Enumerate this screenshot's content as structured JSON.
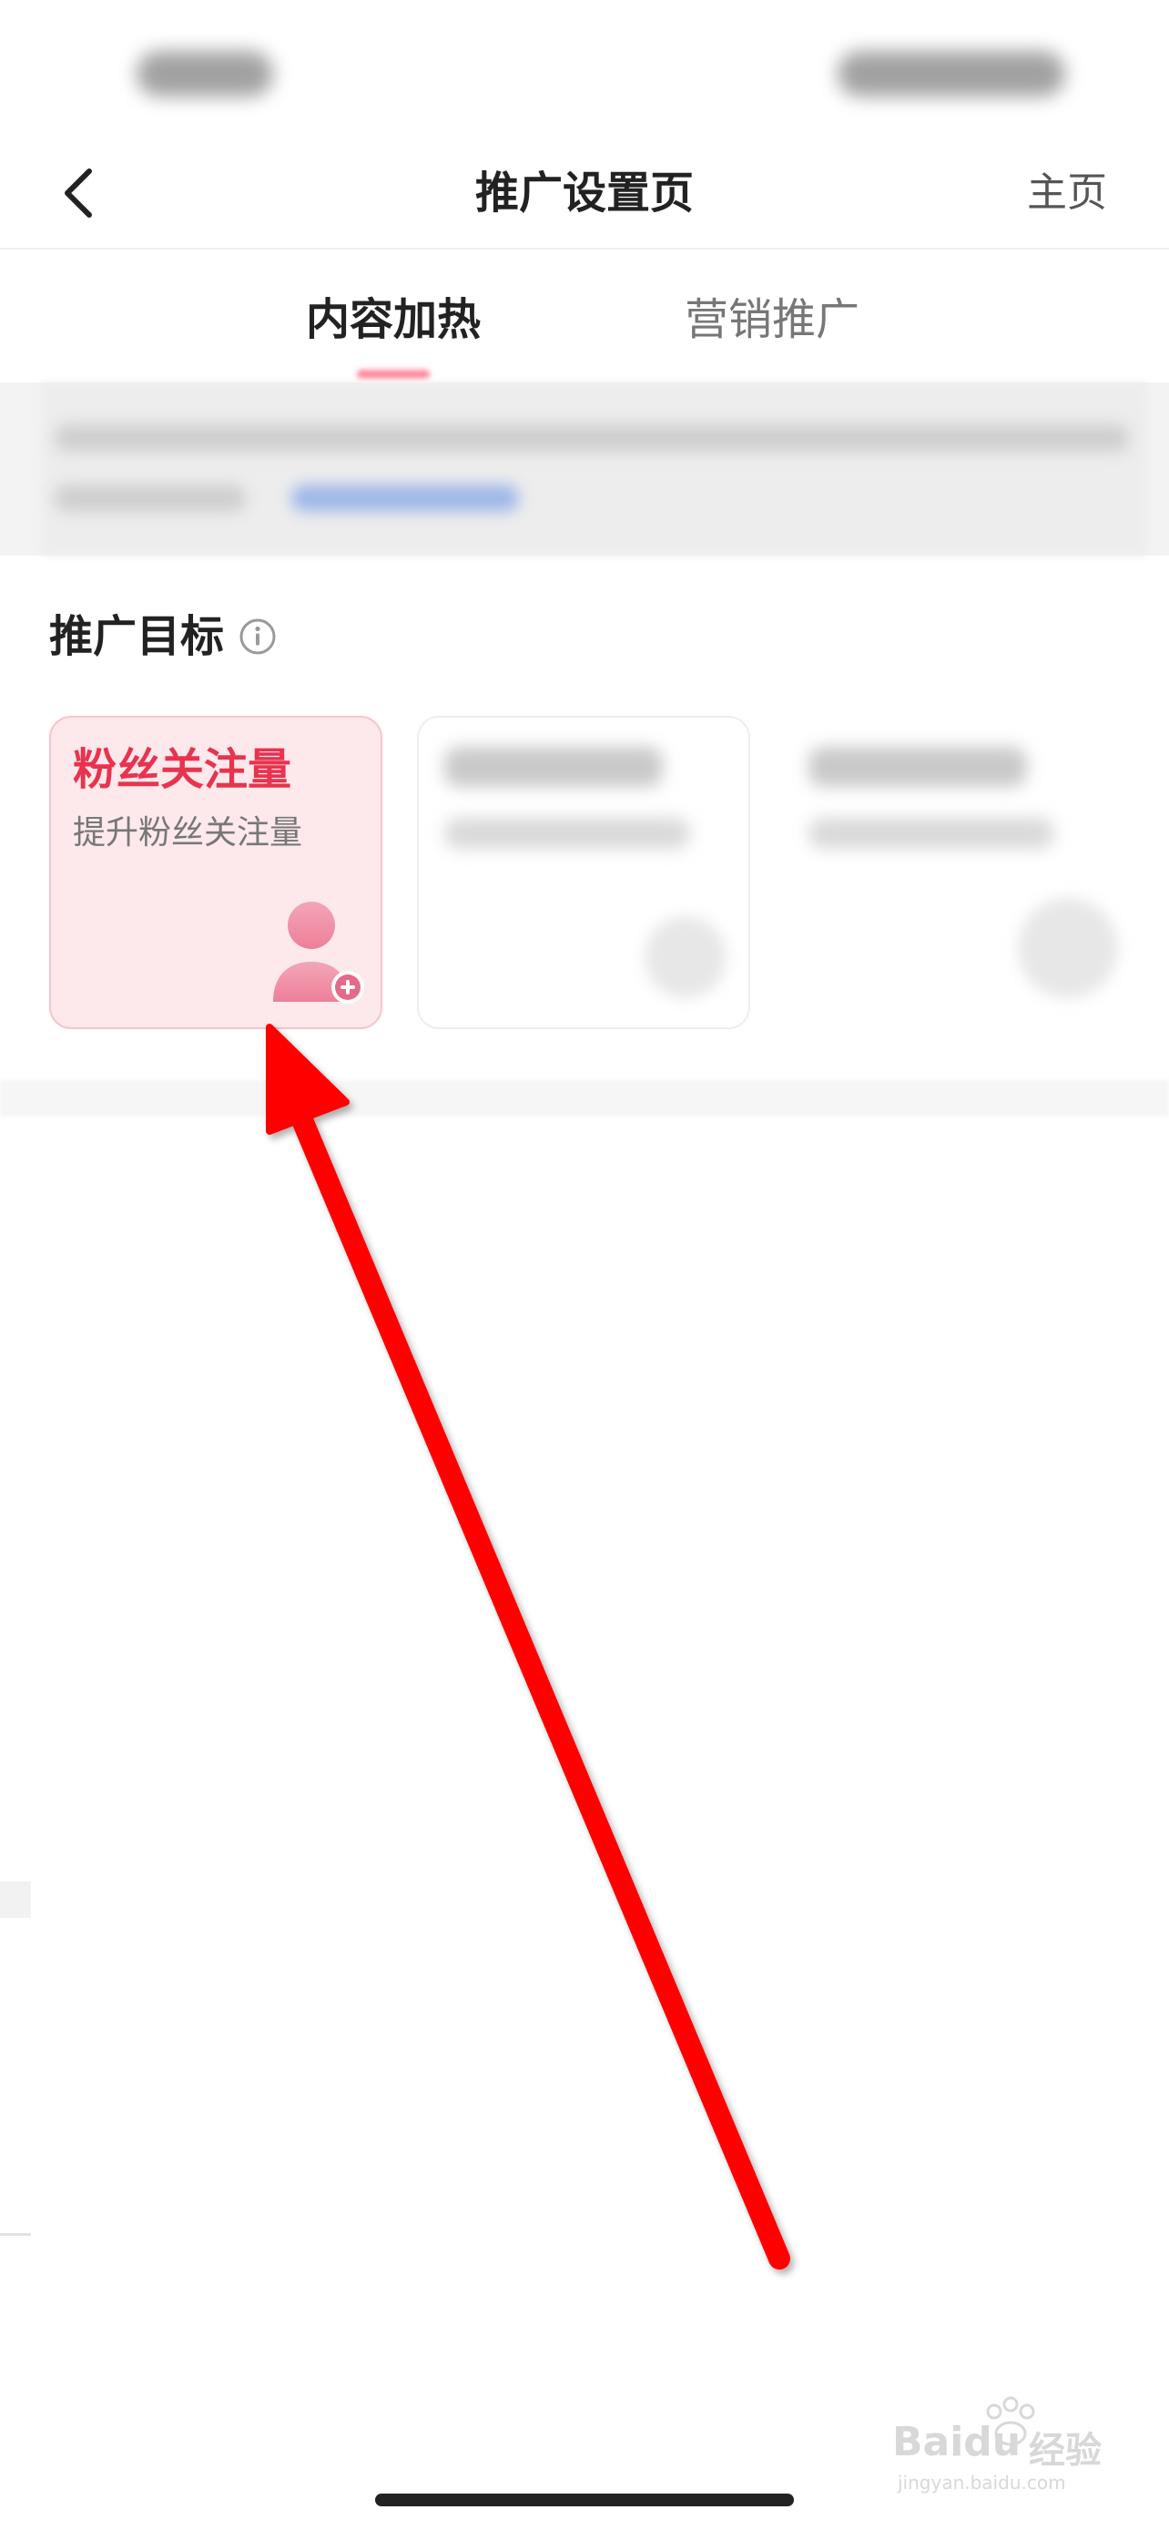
{
  "nav": {
    "title": "推广设置页",
    "home_label": "主页"
  },
  "tabs": [
    {
      "label": "内容加热",
      "active": true
    },
    {
      "label": "营销推广",
      "active": false
    }
  ],
  "section": {
    "title": "推广目标"
  },
  "selected_goal": {
    "title": "粉丝关注量",
    "description": "提升粉丝关注量"
  },
  "watermark": {
    "brand": "Baidu",
    "brand_cn": "经验",
    "domain": "jingyan.baidu.com"
  },
  "colors": {
    "accent": "#e8334f",
    "card_bg": "#fde9ec",
    "annotation_arrow": "#ff0000"
  },
  "icons": {
    "back": "chevron-left-icon",
    "info": "info-icon",
    "goal": "user-add-icon"
  }
}
